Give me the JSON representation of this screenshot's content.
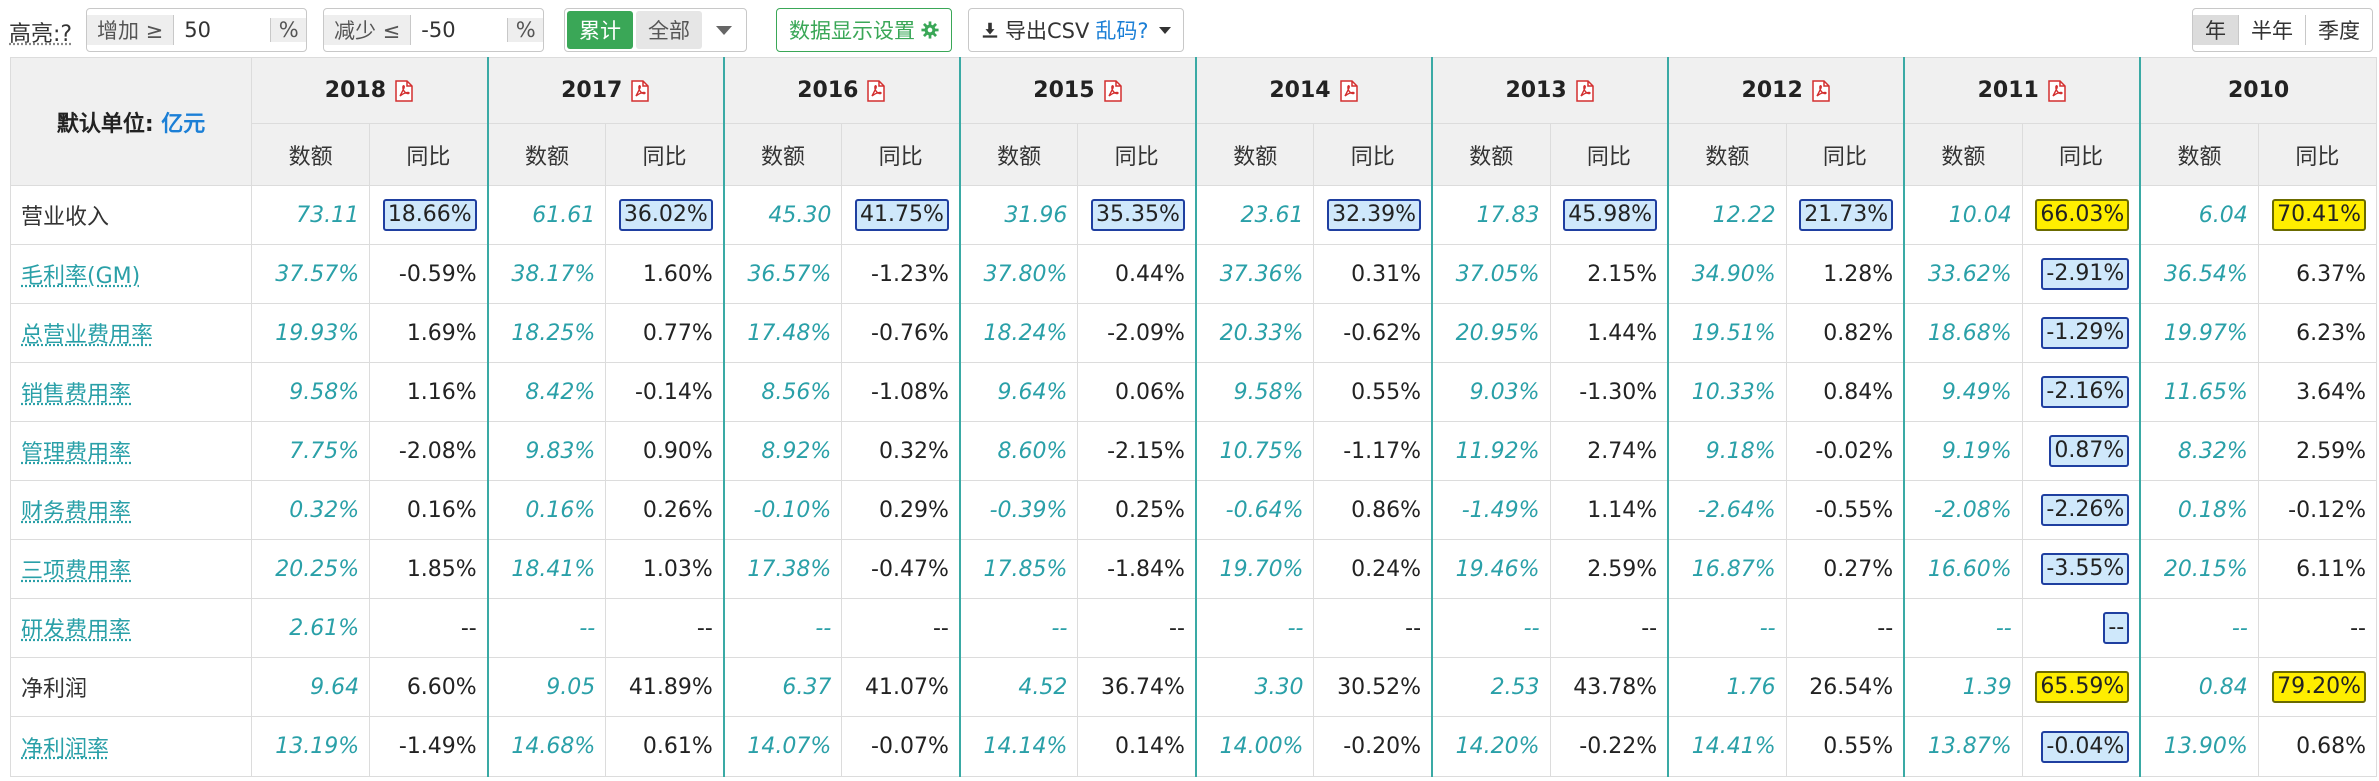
{
  "toolbar": {
    "highlight_label": "高亮:?",
    "increase_label": "增加 ≥",
    "increase_value": "50",
    "percent": "%",
    "decrease_label": "减少 ≤",
    "decrease_value": "-50",
    "mode_active": "累计",
    "mode_other": "全部",
    "display_settings": "数据显示设置",
    "export_csv": "导出CSV",
    "garbled": "乱码?",
    "periods": [
      "年",
      "半年",
      "季度"
    ],
    "active_period": "年"
  },
  "table": {
    "unit_label": "默认单位:",
    "unit_value": "亿元",
    "years": [
      "2018",
      "2017",
      "2016",
      "2015",
      "2014",
      "2013",
      "2012",
      "2011",
      "2010"
    ],
    "years_with_pdf": [
      "2018",
      "2017",
      "2016",
      "2015",
      "2014",
      "2013",
      "2012",
      "2011"
    ],
    "sub_headers": [
      "数额",
      "同比"
    ],
    "rows": [
      {
        "name": "营业收入",
        "link": false,
        "values": [
          "73.11",
          "61.61",
          "45.30",
          "31.96",
          "23.61",
          "17.83",
          "12.22",
          "10.04",
          "6.04"
        ],
        "yoy": [
          "18.66%",
          "36.02%",
          "41.75%",
          "35.35%",
          "32.39%",
          "45.98%",
          "21.73%",
          "66.03%",
          "70.41%"
        ],
        "hl": [
          "b",
          "b",
          "b",
          "b",
          "b",
          "b",
          "b",
          "y",
          "y"
        ]
      },
      {
        "name": "毛利率(GM)",
        "link": true,
        "values": [
          "37.57%",
          "38.17%",
          "36.57%",
          "37.80%",
          "37.36%",
          "37.05%",
          "34.90%",
          "33.62%",
          "36.54%"
        ],
        "yoy": [
          "-0.59%",
          "1.60%",
          "-1.23%",
          "0.44%",
          "0.31%",
          "2.15%",
          "1.28%",
          "-2.91%",
          "6.37%"
        ],
        "hl": [
          "",
          "",
          "",
          "",
          "",
          "",
          "",
          "b",
          ""
        ]
      },
      {
        "name": "总营业费用率",
        "link": true,
        "values": [
          "19.93%",
          "18.25%",
          "17.48%",
          "18.24%",
          "20.33%",
          "20.95%",
          "19.51%",
          "18.68%",
          "19.97%"
        ],
        "yoy": [
          "1.69%",
          "0.77%",
          "-0.76%",
          "-2.09%",
          "-0.62%",
          "1.44%",
          "0.82%",
          "-1.29%",
          "6.23%"
        ],
        "hl": [
          "",
          "",
          "",
          "",
          "",
          "",
          "",
          "b",
          ""
        ]
      },
      {
        "name": "销售费用率",
        "link": true,
        "values": [
          "9.58%",
          "8.42%",
          "8.56%",
          "9.64%",
          "9.58%",
          "9.03%",
          "10.33%",
          "9.49%",
          "11.65%"
        ],
        "yoy": [
          "1.16%",
          "-0.14%",
          "-1.08%",
          "0.06%",
          "0.55%",
          "-1.30%",
          "0.84%",
          "-2.16%",
          "3.64%"
        ],
        "hl": [
          "",
          "",
          "",
          "",
          "",
          "",
          "",
          "b",
          ""
        ]
      },
      {
        "name": "管理费用率",
        "link": true,
        "values": [
          "7.75%",
          "9.83%",
          "8.92%",
          "8.60%",
          "10.75%",
          "11.92%",
          "9.18%",
          "9.19%",
          "8.32%"
        ],
        "yoy": [
          "-2.08%",
          "0.90%",
          "0.32%",
          "-2.15%",
          "-1.17%",
          "2.74%",
          "-0.02%",
          "0.87%",
          "2.59%"
        ],
        "hl": [
          "",
          "",
          "",
          "",
          "",
          "",
          "",
          "b",
          ""
        ]
      },
      {
        "name": "财务费用率",
        "link": true,
        "values": [
          "0.32%",
          "0.16%",
          "-0.10%",
          "-0.39%",
          "-0.64%",
          "-1.49%",
          "-2.64%",
          "-2.08%",
          "0.18%"
        ],
        "yoy": [
          "0.16%",
          "0.26%",
          "0.29%",
          "0.25%",
          "0.86%",
          "1.14%",
          "-0.55%",
          "-2.26%",
          "-0.12%"
        ],
        "hl": [
          "",
          "",
          "",
          "",
          "",
          "",
          "",
          "b",
          ""
        ]
      },
      {
        "name": "三项费用率",
        "link": true,
        "values": [
          "20.25%",
          "18.41%",
          "17.38%",
          "17.85%",
          "19.70%",
          "19.46%",
          "16.87%",
          "16.60%",
          "20.15%"
        ],
        "yoy": [
          "1.85%",
          "1.03%",
          "-0.47%",
          "-1.84%",
          "0.24%",
          "2.59%",
          "0.27%",
          "-3.55%",
          "6.11%"
        ],
        "hl": [
          "",
          "",
          "",
          "",
          "",
          "",
          "",
          "b",
          ""
        ]
      },
      {
        "name": "研发费用率",
        "link": true,
        "values": [
          "2.61%",
          "--",
          "--",
          "--",
          "--",
          "--",
          "--",
          "--",
          "--"
        ],
        "yoy": [
          "--",
          "--",
          "--",
          "--",
          "--",
          "--",
          "--",
          "--",
          "--"
        ],
        "hl": [
          "",
          "",
          "",
          "",
          "",
          "",
          "",
          "b",
          ""
        ]
      },
      {
        "name": "净利润",
        "link": false,
        "values": [
          "9.64",
          "9.05",
          "6.37",
          "4.52",
          "3.30",
          "2.53",
          "1.76",
          "1.39",
          "0.84"
        ],
        "yoy": [
          "6.60%",
          "41.89%",
          "41.07%",
          "36.74%",
          "30.52%",
          "43.78%",
          "26.54%",
          "65.59%",
          "79.20%"
        ],
        "hl": [
          "",
          "",
          "",
          "",
          "",
          "",
          "",
          "y",
          "y"
        ]
      },
      {
        "name": "净利润率",
        "link": true,
        "values": [
          "13.19%",
          "14.68%",
          "14.07%",
          "14.14%",
          "14.00%",
          "14.20%",
          "14.41%",
          "13.87%",
          "13.90%"
        ],
        "yoy": [
          "-1.49%",
          "0.61%",
          "-0.07%",
          "0.14%",
          "-0.20%",
          "-0.22%",
          "0.55%",
          "-0.04%",
          "0.68%"
        ],
        "hl": [
          "",
          "",
          "",
          "",
          "",
          "",
          "",
          "b",
          ""
        ]
      }
    ]
  },
  "colors": {
    "accent_green": "#3aa757",
    "value_teal": "#2aa0a8",
    "highlight_blue": "#cfe8fb",
    "highlight_yellow": "#ffee00",
    "link_blue": "#1b7fd6"
  },
  "icons": {
    "pdf": "pdf-icon",
    "gear": "gear-icon",
    "download": "download-icon",
    "dropdown": "chevron-down-icon"
  }
}
